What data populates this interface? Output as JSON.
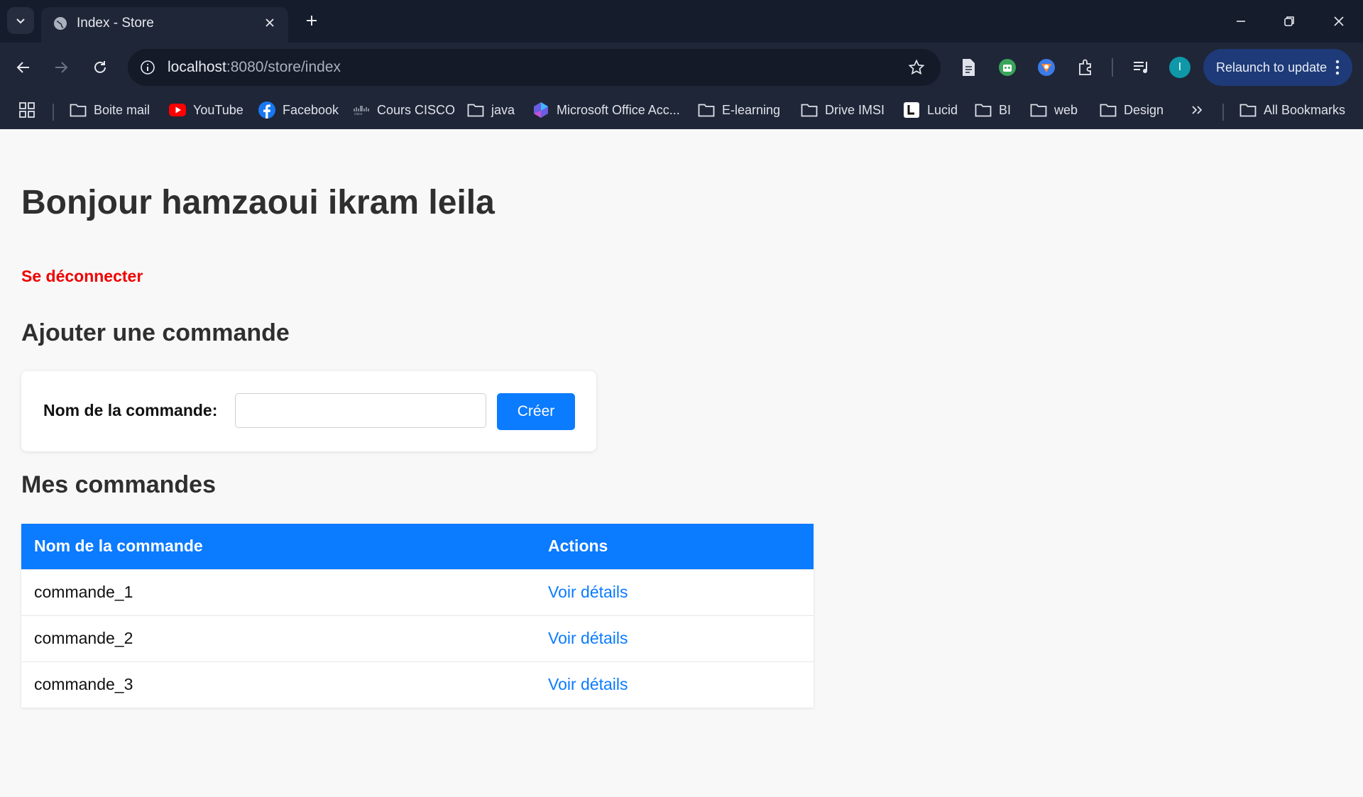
{
  "browser": {
    "tab_title": "Index - Store",
    "url_host": "localhost",
    "url_rest": ":8080/store/index",
    "profile_initial": "I",
    "relaunch_label": "Relaunch to update",
    "bookmarks": [
      {
        "label": "Boite mail",
        "icon": "folder-icon"
      },
      {
        "label": "YouTube",
        "icon": "youtube-icon"
      },
      {
        "label": "Facebook",
        "icon": "facebook-icon"
      },
      {
        "label": "Cours CISCO",
        "icon": "cisco-icon"
      },
      {
        "label": "java",
        "icon": "folder-icon"
      },
      {
        "label": "Microsoft Office Acc...",
        "icon": "office-icon"
      },
      {
        "label": "E-learning",
        "icon": "folder-icon"
      },
      {
        "label": "Drive IMSI",
        "icon": "folder-icon"
      },
      {
        "label": "Lucid",
        "icon": "lucid-icon"
      },
      {
        "label": "BI",
        "icon": "folder-icon"
      },
      {
        "label": "web",
        "icon": "folder-icon"
      },
      {
        "label": "Design",
        "icon": "folder-icon"
      }
    ],
    "all_bookmarks_label": "All Bookmarks",
    "colors": {
      "chrome_bg": "#1f2637",
      "tabstrip_bg": "#151c2c",
      "relaunch_bg": "#1e3a78"
    }
  },
  "page": {
    "greeting": "Bonjour hamzaoui ikram leila",
    "logout_label": "Se déconnecter",
    "add_section_title": "Ajouter une commande",
    "form": {
      "label": "Nom de la commande:",
      "input_value": "",
      "submit_label": "Créer"
    },
    "orders_section_title": "Mes commandes",
    "table": {
      "headers": [
        "Nom de la commande",
        "Actions"
      ],
      "rows": [
        {
          "name": "commande_1",
          "action": "Voir détails"
        },
        {
          "name": "commande_2",
          "action": "Voir détails"
        },
        {
          "name": "commande_3",
          "action": "Voir détails"
        }
      ]
    },
    "colors": {
      "accent": "#0b7bff",
      "logout": "#f00000",
      "text": "#2f2f2f"
    }
  }
}
